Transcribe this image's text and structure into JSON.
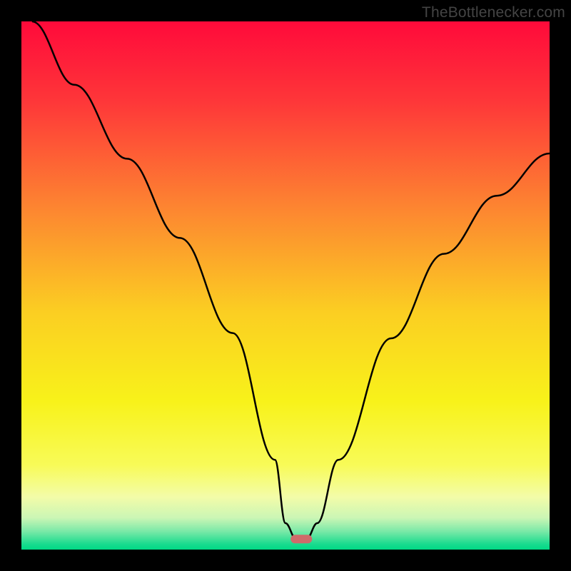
{
  "watermark": "TheBottlenecker.com",
  "chart_data": {
    "type": "line",
    "title": "",
    "xlabel": "",
    "ylabel": "",
    "xlim": [
      0,
      100
    ],
    "ylim": [
      0,
      100
    ],
    "series": [
      {
        "name": "bottleneck-curve",
        "x": [
          2,
          10,
          20,
          30,
          40,
          48,
          50,
          52,
          54,
          56,
          60,
          70,
          80,
          90,
          100
        ],
        "values": [
          100,
          88,
          74,
          59,
          41,
          17,
          5,
          2,
          2,
          5,
          17,
          40,
          56,
          67,
          75
        ]
      }
    ],
    "marker": {
      "x": 53,
      "y": 2,
      "color": "#cf6a6a"
    },
    "background_gradient": {
      "stops": [
        {
          "pos": 0.0,
          "color": "#ff0a3a"
        },
        {
          "pos": 0.15,
          "color": "#fe3639"
        },
        {
          "pos": 0.35,
          "color": "#fd8431"
        },
        {
          "pos": 0.55,
          "color": "#fbce22"
        },
        {
          "pos": 0.72,
          "color": "#f8f21a"
        },
        {
          "pos": 0.84,
          "color": "#f8fb58"
        },
        {
          "pos": 0.9,
          "color": "#f3fca8"
        },
        {
          "pos": 0.94,
          "color": "#cbf6b5"
        },
        {
          "pos": 0.965,
          "color": "#7ce9a8"
        },
        {
          "pos": 0.99,
          "color": "#18db8e"
        },
        {
          "pos": 1.0,
          "color": "#00d985"
        }
      ]
    }
  }
}
